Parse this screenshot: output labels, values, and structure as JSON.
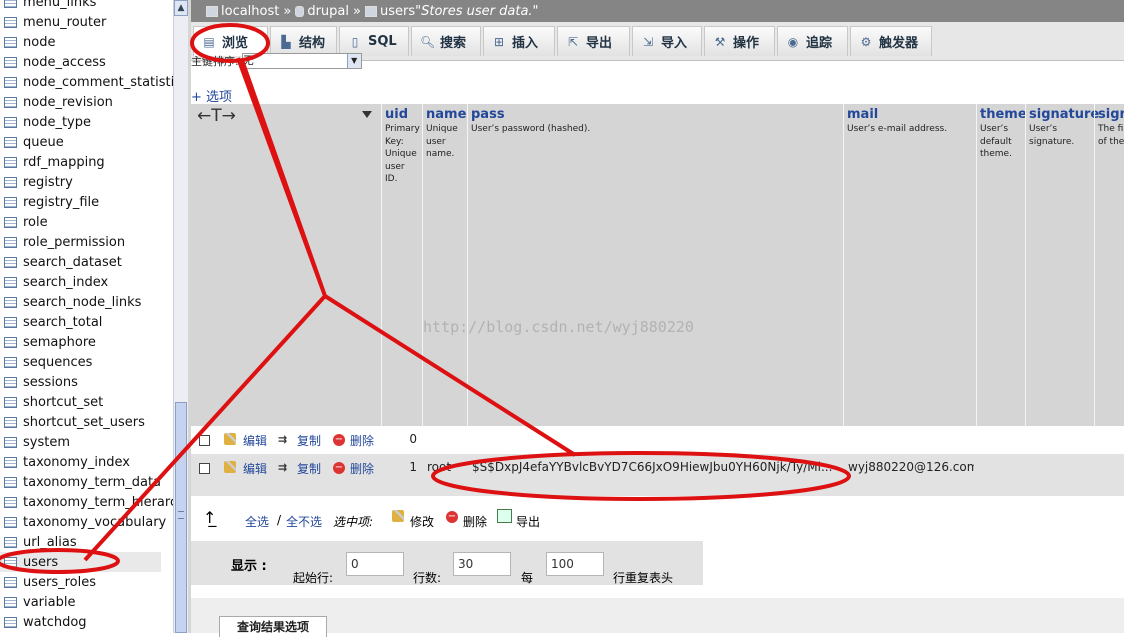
{
  "sidebar": {
    "items": [
      {
        "label": "menu_links"
      },
      {
        "label": "menu_router"
      },
      {
        "label": "node"
      },
      {
        "label": "node_access"
      },
      {
        "label": "node_comment_statistics"
      },
      {
        "label": "node_revision"
      },
      {
        "label": "node_type"
      },
      {
        "label": "queue"
      },
      {
        "label": "rdf_mapping"
      },
      {
        "label": "registry"
      },
      {
        "label": "registry_file"
      },
      {
        "label": "role"
      },
      {
        "label": "role_permission"
      },
      {
        "label": "search_dataset"
      },
      {
        "label": "search_index"
      },
      {
        "label": "search_node_links"
      },
      {
        "label": "search_total"
      },
      {
        "label": "semaphore"
      },
      {
        "label": "sequences"
      },
      {
        "label": "sessions"
      },
      {
        "label": "shortcut_set"
      },
      {
        "label": "shortcut_set_users"
      },
      {
        "label": "system"
      },
      {
        "label": "taxonomy_index"
      },
      {
        "label": "taxonomy_term_data"
      },
      {
        "label": "taxonomy_term_hierarchy"
      },
      {
        "label": "taxonomy_vocabulary"
      },
      {
        "label": "url_alias"
      },
      {
        "label": "users",
        "selected": true
      },
      {
        "label": "users_roles"
      },
      {
        "label": "variable"
      },
      {
        "label": "watchdog"
      }
    ]
  },
  "breadcrumb": {
    "server": "localhost",
    "sep": "»",
    "database": "drupal",
    "table": "users",
    "comment": "\"Stores user data.\""
  },
  "tabs": [
    {
      "label": "浏览",
      "icon": "browse-icon",
      "active": true
    },
    {
      "label": "结构",
      "icon": "structure-icon"
    },
    {
      "label": "SQL",
      "icon": "sql-icon"
    },
    {
      "label": "搜索",
      "icon": "search-icon"
    },
    {
      "label": "插入",
      "icon": "insert-icon"
    },
    {
      "label": "导出",
      "icon": "export-icon"
    },
    {
      "label": "导入",
      "icon": "import-icon"
    },
    {
      "label": "操作",
      "icon": "wrench-icon"
    },
    {
      "label": "追踪",
      "icon": "eye-icon"
    },
    {
      "label": "触发器",
      "icon": "trigger-icon"
    }
  ],
  "sort": {
    "label": "主键排序:",
    "value": "无"
  },
  "options_link": "+ 选项",
  "columns": [
    {
      "name": "uid",
      "comment": [
        "Primary",
        "Key:",
        "Unique",
        "user",
        "ID."
      ]
    },
    {
      "name": "name",
      "comment": [
        "Unique",
        "user",
        "name."
      ]
    },
    {
      "name": "pass",
      "comment": [
        "User’s password (hashed)."
      ]
    },
    {
      "name": "mail",
      "comment": [
        "User’s e-mail address."
      ]
    },
    {
      "name": "theme",
      "comment": [
        "User’s",
        "default",
        "theme."
      ]
    },
    {
      "name": "signature",
      "comment": [
        "User’s",
        "signature."
      ]
    },
    {
      "name": "sign",
      "comment": [
        "The fi",
        "of the"
      ]
    }
  ],
  "row_actions": {
    "edit": "编辑",
    "copy": "复制",
    "delete": "删除"
  },
  "rows": [
    {
      "uid": "0",
      "name": "",
      "pass": "",
      "mail": ""
    },
    {
      "uid": "1",
      "name": "root",
      "pass": "$S$DxpJ4efaYYBvlcBvYD7C66JxO9HiewJbu0YH60Njk/Ty/Mi...",
      "mail": "wyj880220@126.com"
    }
  ],
  "multi": {
    "check_all": "全选",
    "separator": "/",
    "uncheck_all": "全不选",
    "with_selected": "选中项:",
    "edit": "修改",
    "delete": "删除",
    "export": "导出"
  },
  "display": {
    "title": "显示 :",
    "start_label": "起始行:",
    "start_value": "0",
    "rows_label": "行数:",
    "rows_value": "30",
    "per_label": "每",
    "per_value": "100",
    "repeat_label": "行重复表头"
  },
  "query_results_tab": "查询结果选项",
  "watermark": "http://blog.csdn.net/wyj880220",
  "annotation_color": "#dd1111"
}
